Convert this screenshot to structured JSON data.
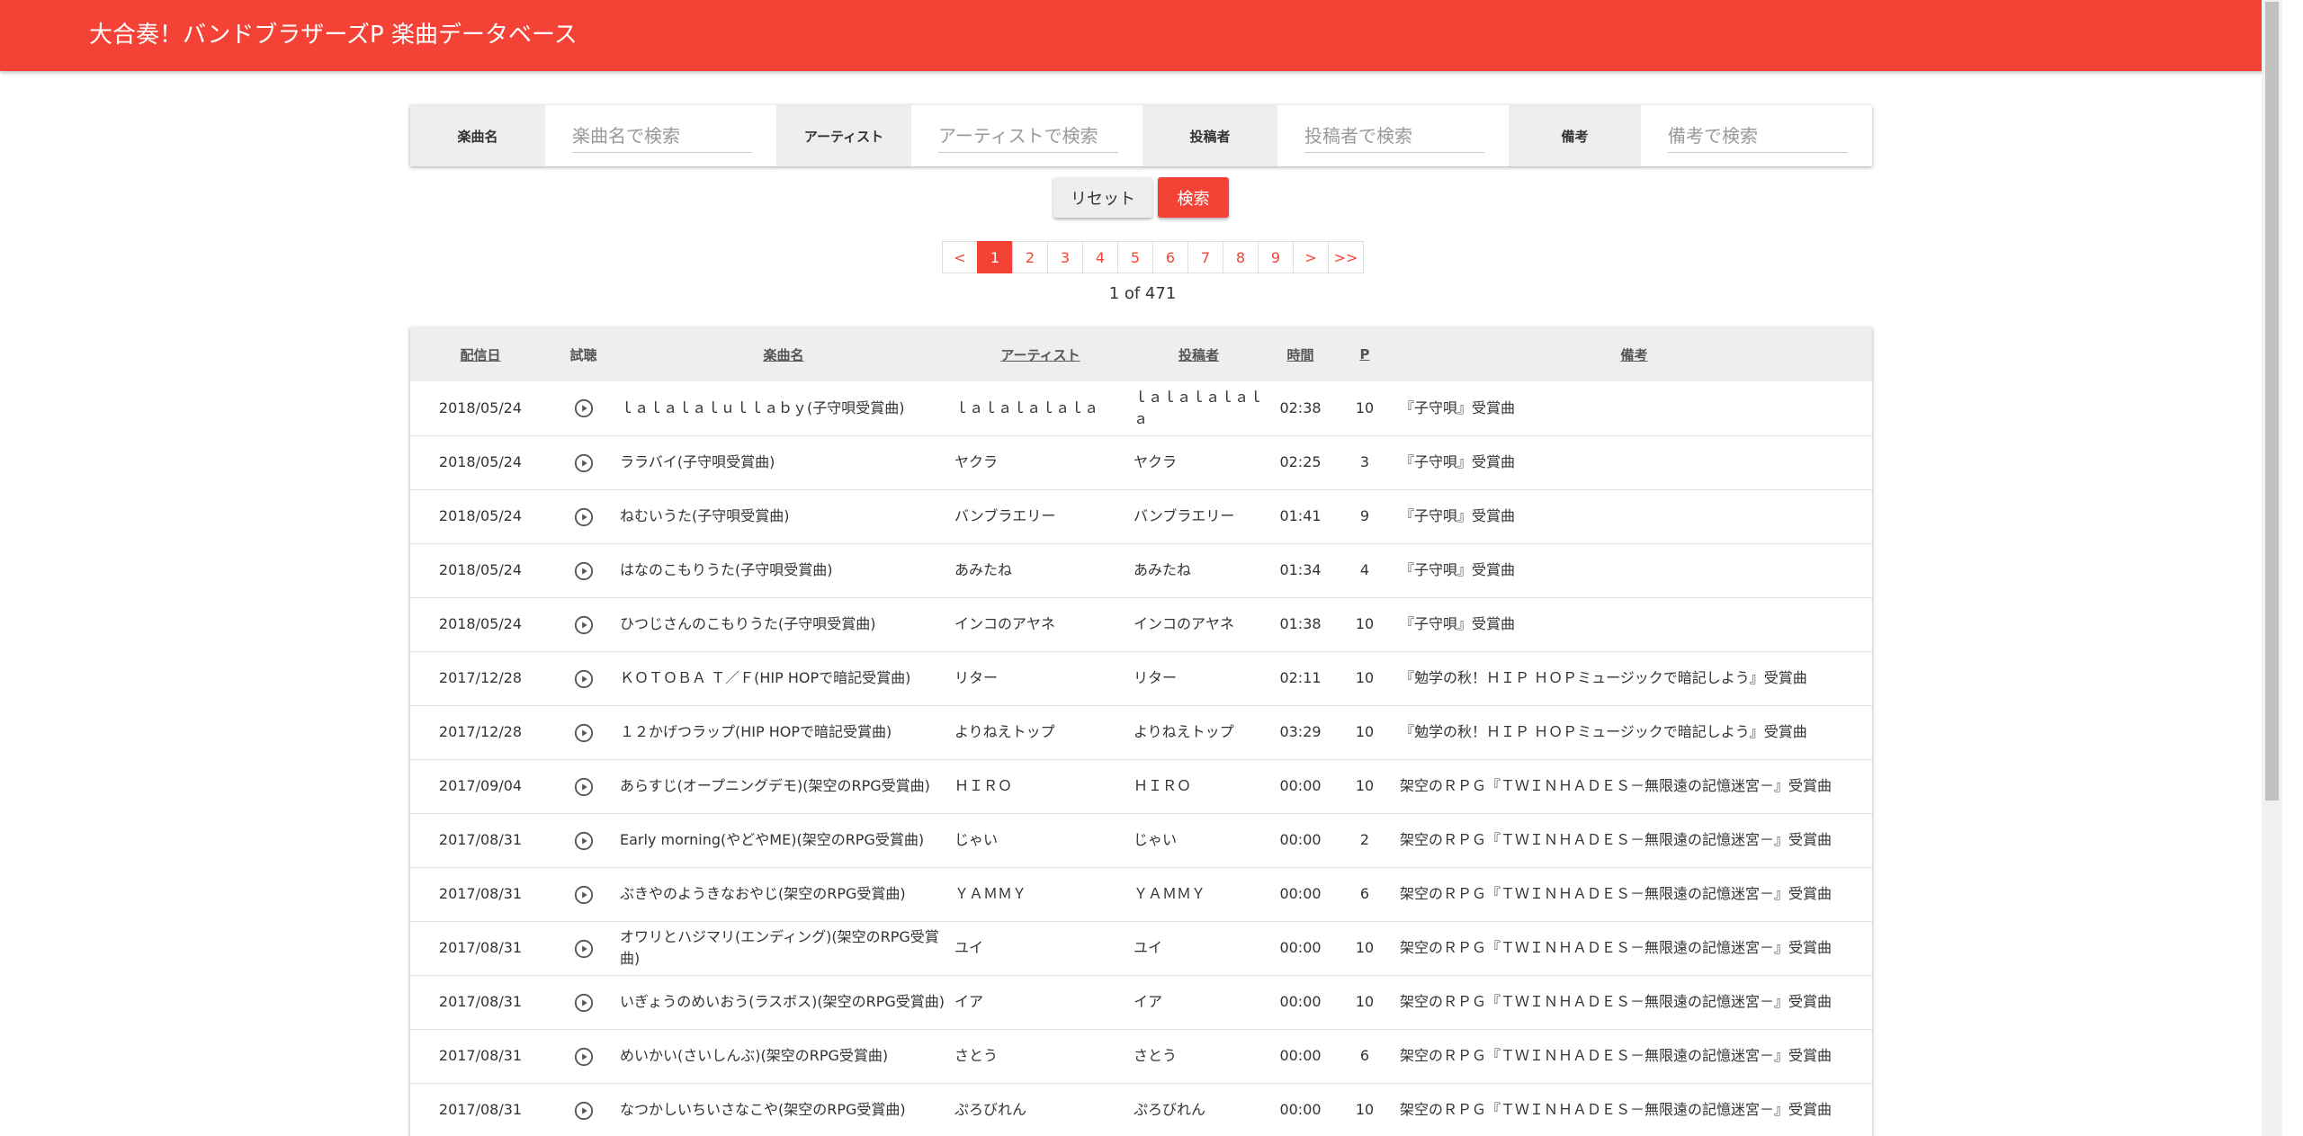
{
  "header": {
    "title": "大合奏！バンドブラザーズP 楽曲データベース"
  },
  "search": {
    "fields": [
      {
        "label": "楽曲名",
        "placeholder": "楽曲名で検索"
      },
      {
        "label": "アーティスト",
        "placeholder": "アーティストで検索"
      },
      {
        "label": "投稿者",
        "placeholder": "投稿者で検索"
      },
      {
        "label": "備考",
        "placeholder": "備考で検索"
      }
    ],
    "reset_label": "リセット",
    "search_label": "検索"
  },
  "pagination": {
    "prev": "<",
    "pages": [
      "1",
      "2",
      "3",
      "4",
      "5",
      "6",
      "7",
      "8",
      "9"
    ],
    "active": "1",
    "next": ">",
    "last": ">>",
    "info": "1 of 471"
  },
  "table": {
    "headers": [
      "配信日",
      "試聴",
      "楽曲名",
      "アーティスト",
      "投稿者",
      "時間",
      "P",
      "備考"
    ],
    "rows": [
      [
        "2018/05/24",
        "",
        "ｌａｌａｌａｌｕｌｌａｂｙ(子守唄受賞曲)",
        "ｌａｌａｌａｌａｌａ",
        "ｌａｌａｌａｌａｌａ",
        "02:38",
        "10",
        "『子守唄』受賞曲"
      ],
      [
        "2018/05/24",
        "",
        "ララバイ(子守唄受賞曲)",
        "ヤクラ",
        "ヤクラ",
        "02:25",
        "3",
        "『子守唄』受賞曲"
      ],
      [
        "2018/05/24",
        "",
        "ねむいうた(子守唄受賞曲)",
        "バンブラエリー",
        "バンブラエリー",
        "01:41",
        "9",
        "『子守唄』受賞曲"
      ],
      [
        "2018/05/24",
        "",
        "はなのこもりうた(子守唄受賞曲)",
        "あみたね",
        "あみたね",
        "01:34",
        "4",
        "『子守唄』受賞曲"
      ],
      [
        "2018/05/24",
        "",
        "ひつじさんのこもりうた(子守唄受賞曲)",
        "インコのアヤネ",
        "インコのアヤネ",
        "01:38",
        "10",
        "『子守唄』受賞曲"
      ],
      [
        "2017/12/28",
        "",
        "ＫＯＴＯＢＡ Ｔ／Ｆ(HIP HOPで暗記受賞曲)",
        "リター",
        "リター",
        "02:11",
        "10",
        "『勉学の秋！ＨＩＰ ＨＯＰミュージックで暗記しよう』受賞曲"
      ],
      [
        "2017/12/28",
        "",
        "１２かげつラップ(HIP HOPで暗記受賞曲)",
        "よりねえトップ",
        "よりねえトップ",
        "03:29",
        "10",
        "『勉学の秋！ＨＩＰ ＨＯＰミュージックで暗記しよう』受賞曲"
      ],
      [
        "2017/09/04",
        "",
        "あらすじ(オープニングデモ)(架空のRPG受賞曲)",
        "ＨＩＲＯ",
        "ＨＩＲＯ",
        "00:00",
        "10",
        "架空のＲＰＧ『ＴＷＩＮＨＡＤＥＳ－無限遠の記憶迷宮－』受賞曲"
      ],
      [
        "2017/08/31",
        "",
        "Early morning(やどやME)(架空のRPG受賞曲)",
        "じゃい",
        "じゃい",
        "00:00",
        "2",
        "架空のＲＰＧ『ＴＷＩＮＨＡＤＥＳ－無限遠の記憶迷宮－』受賞曲"
      ],
      [
        "2017/08/31",
        "",
        "ぶきやのようきなおやじ(架空のRPG受賞曲)",
        "ＹＡＭＭＹ",
        "ＹＡＭＭＹ",
        "00:00",
        "6",
        "架空のＲＰＧ『ＴＷＩＮＨＡＤＥＳ－無限遠の記憶迷宮－』受賞曲"
      ],
      [
        "2017/08/31",
        "",
        "オワリとハジマリ(エンディング)(架空のRPG受賞曲)",
        "ユイ",
        "ユイ",
        "00:00",
        "10",
        "架空のＲＰＧ『ＴＷＩＮＨＡＤＥＳ－無限遠の記憶迷宮－』受賞曲"
      ],
      [
        "2017/08/31",
        "",
        "いぎょうのめいおう(ラスボス)(架空のRPG受賞曲)",
        "イア",
        "イア",
        "00:00",
        "10",
        "架空のＲＰＧ『ＴＷＩＮＨＡＤＥＳ－無限遠の記憶迷宮－』受賞曲"
      ],
      [
        "2017/08/31",
        "",
        "めいかい(さいしんぶ)(架空のRPG受賞曲)",
        "さとう",
        "さとう",
        "00:00",
        "6",
        "架空のＲＰＧ『ＴＷＩＮＨＡＤＥＳ－無限遠の記憶迷宮－』受賞曲"
      ],
      [
        "2017/08/31",
        "",
        "なつかしいちいさなこや(架空のRPG受賞曲)",
        "ぷろびれん",
        "ぷろびれん",
        "00:00",
        "10",
        "架空のＲＰＧ『ＴＷＩＮＨＡＤＥＳ－無限遠の記憶迷宮－』受賞曲"
      ]
    ]
  },
  "colors": {
    "accent": "#f44336",
    "header_bg": "#eeeeee"
  },
  "icons": {
    "play": "play-circle-icon"
  }
}
